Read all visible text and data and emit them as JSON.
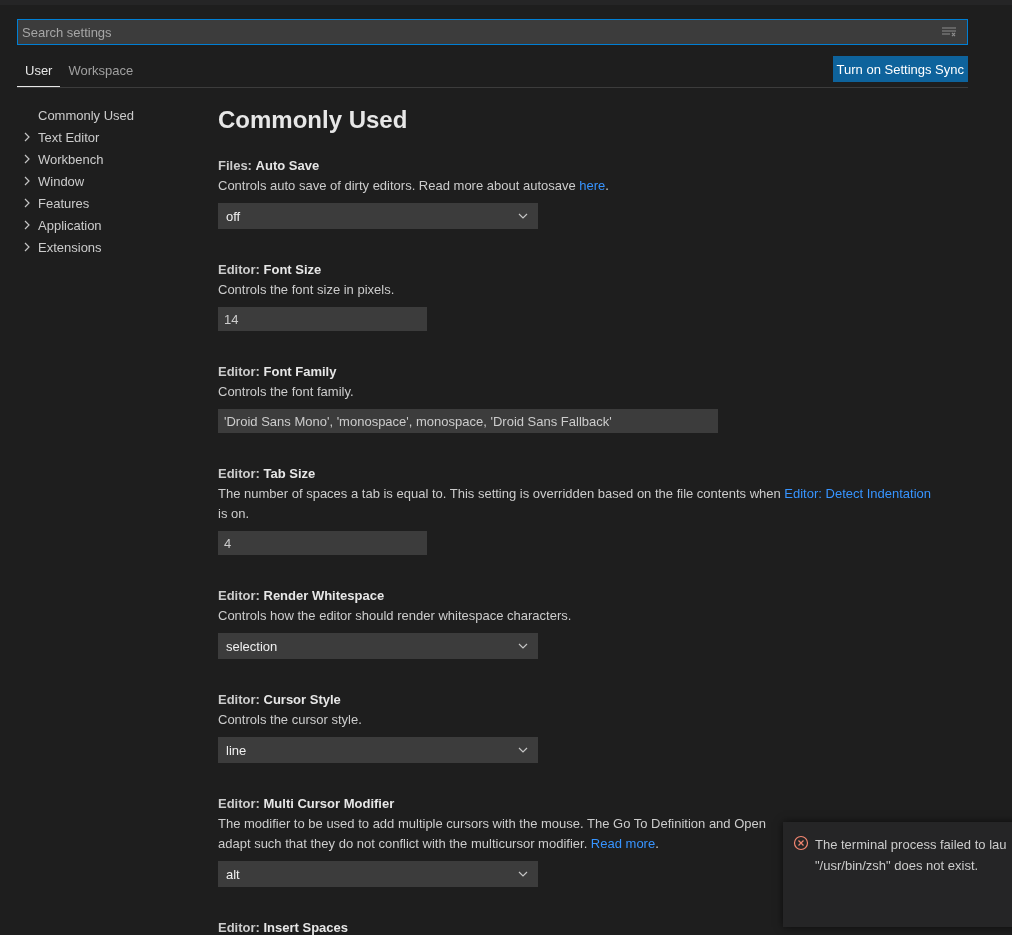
{
  "search": {
    "placeholder": "Search settings"
  },
  "tabs": [
    {
      "label": "User",
      "selected": true
    },
    {
      "label": "Workspace",
      "selected": false
    }
  ],
  "sync_button": "Turn on Settings Sync",
  "sidebar": {
    "items": [
      {
        "label": "Commonly Used",
        "expandable": false
      },
      {
        "label": "Text Editor",
        "expandable": true
      },
      {
        "label": "Workbench",
        "expandable": true
      },
      {
        "label": "Window",
        "expandable": true
      },
      {
        "label": "Features",
        "expandable": true
      },
      {
        "label": "Application",
        "expandable": true
      },
      {
        "label": "Extensions",
        "expandable": true
      }
    ]
  },
  "section_title": "Commonly Used",
  "settings": [
    {
      "category": "Files: ",
      "name": "Auto Save",
      "description": [
        {
          "kind": "text",
          "text": "Controls auto save of dirty editors. Read more about autosave "
        },
        {
          "kind": "link",
          "text": "here"
        },
        {
          "kind": "text",
          "text": "."
        }
      ],
      "control": {
        "kind": "select",
        "value": "off"
      }
    },
    {
      "category": "Editor: ",
      "name": "Font Size",
      "description": [
        {
          "kind": "text",
          "text": "Controls the font size in pixels."
        }
      ],
      "control": {
        "kind": "text",
        "value": "14"
      }
    },
    {
      "category": "Editor: ",
      "name": "Font Family",
      "description": [
        {
          "kind": "text",
          "text": "Controls the font family."
        }
      ],
      "control": {
        "kind": "wide",
        "value": "'Droid Sans Mono', 'monospace', monospace, 'Droid Sans Fallback'"
      }
    },
    {
      "category": "Editor: ",
      "name": "Tab Size",
      "description": [
        {
          "kind": "text",
          "text": "The number of spaces a tab is equal to. This setting is overridden based on the file contents when "
        },
        {
          "kind": "link",
          "text": "Editor: Detect Indentation"
        },
        {
          "kind": "text",
          "text": " is on."
        }
      ],
      "control": {
        "kind": "text",
        "value": "4"
      }
    },
    {
      "category": "Editor: ",
      "name": "Render Whitespace",
      "description": [
        {
          "kind": "text",
          "text": "Controls how the editor should render whitespace characters."
        }
      ],
      "control": {
        "kind": "select",
        "value": "selection"
      }
    },
    {
      "category": "Editor: ",
      "name": "Cursor Style",
      "description": [
        {
          "kind": "text",
          "text": "Controls the cursor style."
        }
      ],
      "control": {
        "kind": "select",
        "value": "line"
      }
    },
    {
      "category": "Editor: ",
      "name": "Multi Cursor Modifier",
      "description": [
        {
          "kind": "text",
          "text": "The modifier to be used to add multiple cursors with the mouse. The Go To Definition and Open"
        },
        {
          "kind": "break"
        },
        {
          "kind": "text",
          "text": "adapt such that they do not conflict with the multicursor modifier. "
        },
        {
          "kind": "link",
          "text": "Read more"
        },
        {
          "kind": "text",
          "text": "."
        }
      ],
      "control": {
        "kind": "select",
        "value": "alt"
      }
    },
    {
      "category": "Editor: ",
      "name": "Insert Spaces"
    }
  ],
  "notification": {
    "lines": [
      "The terminal process failed to lau",
      "\"/usr/bin/zsh\" does not exist."
    ]
  }
}
